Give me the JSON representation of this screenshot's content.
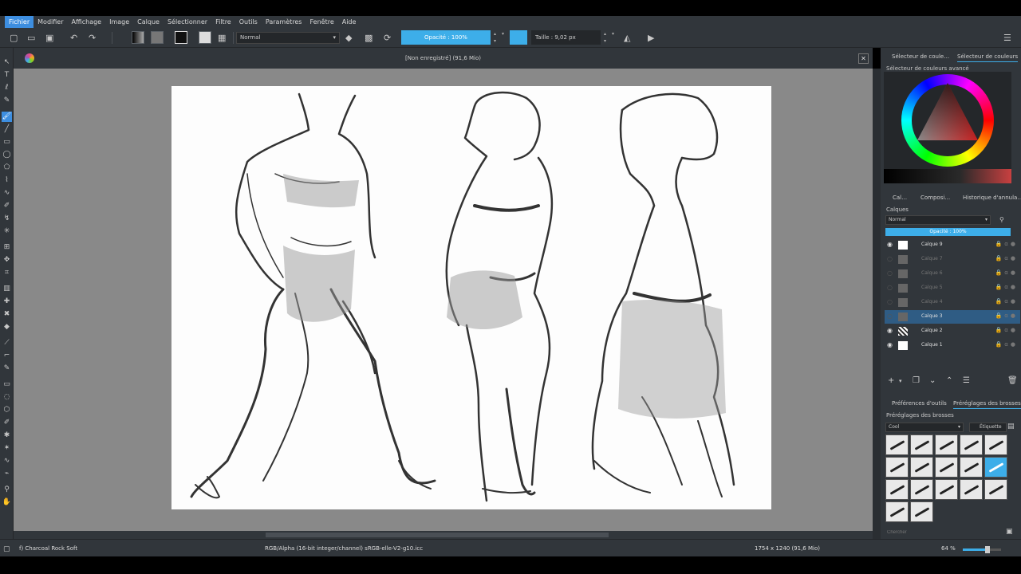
{
  "app": {
    "menu": [
      "Fichier",
      "Modifier",
      "Affichage",
      "Image",
      "Calque",
      "Sélectionner",
      "Filtre",
      "Outils",
      "Paramètres",
      "Fenêtre",
      "Aide"
    ],
    "active_menu_index": 0
  },
  "toolbar": {
    "blend_mode": "Normal",
    "opacity_label": "Opacité : 100%",
    "opacity_value_percent": 100,
    "size_label": "Taille : 9,02 px",
    "brush_color": "#3daee9"
  },
  "document": {
    "title": "[Non enregistré] (91,6 Mio)"
  },
  "dockers": {
    "color_tabs": [
      "Sélecteur de coule…",
      "Sélecteur de couleurs"
    ],
    "color_panel_title": "Sélecteur de couleurs avancé",
    "layer_tabs": [
      "Cal…",
      "Composi…",
      "Historique d'annula…"
    ],
    "layers_title": "Calques",
    "layers_blend": "Normal",
    "layers_opacity_label": "Opacité : 100%",
    "layers": [
      {
        "name": "Calque 9",
        "visible": true,
        "selected": false,
        "dim": false,
        "thumb": "white"
      },
      {
        "name": "Calque 7",
        "visible": false,
        "selected": false,
        "dim": true,
        "thumb": "grey"
      },
      {
        "name": "Calque 6",
        "visible": false,
        "selected": false,
        "dim": true,
        "thumb": "grey"
      },
      {
        "name": "Calque 5",
        "visible": false,
        "selected": false,
        "dim": true,
        "thumb": "grey"
      },
      {
        "name": "Calque 4",
        "visible": false,
        "selected": false,
        "dim": true,
        "thumb": "grey"
      },
      {
        "name": "Calque 3",
        "visible": false,
        "selected": true,
        "dim": false,
        "thumb": "grey"
      },
      {
        "name": "Calque 2",
        "visible": true,
        "selected": false,
        "dim": false,
        "thumb": "pattern"
      },
      {
        "name": "Calque 1",
        "visible": true,
        "selected": false,
        "dim": false,
        "thumb": "white"
      }
    ],
    "brush_tabs": [
      "Préférences d'outils",
      "Préréglages des brosses"
    ],
    "brush_panel_title": "Préréglages des brosses",
    "brush_tag_select": "Cool",
    "brush_tag_button": "Étiquette",
    "search_placeholder": "Chercher"
  },
  "status": {
    "brush_name": "f) Charcoal Rock Soft",
    "color_profile": "RGB/Alpha (16-bit integer/channel)  sRGB-elle-V2-g10.icc",
    "image_size": "1754 x 1240 (91,6 Mio)",
    "zoom": "64 %",
    "zoom_value_percent": 64
  },
  "icons": {
    "tools": [
      "select-icon",
      "text-icon",
      "calligraphy-icon",
      "pen-icon",
      "brush-icon",
      "line-icon",
      "rectangle-icon",
      "ellipse-icon",
      "polygon-icon",
      "polyline-icon",
      "bezier-icon",
      "freehand-path-icon",
      "dynamic-brush-icon",
      "multibrush-icon",
      "transform-icon",
      "move-icon",
      "crop-icon",
      "gradient-icon",
      "color-picker-icon",
      "smart-patch-icon",
      "fill-icon",
      "assistant-icon",
      "measure-icon",
      "reference-icon",
      "rect-select-icon",
      "ellipse-select-icon",
      "polygon-select-icon",
      "freehand-select-icon",
      "contiguous-select-icon",
      "similar-select-icon",
      "bezier-select-icon",
      "magnetic-select-icon",
      "zoom-icon",
      "pan-icon"
    ]
  }
}
